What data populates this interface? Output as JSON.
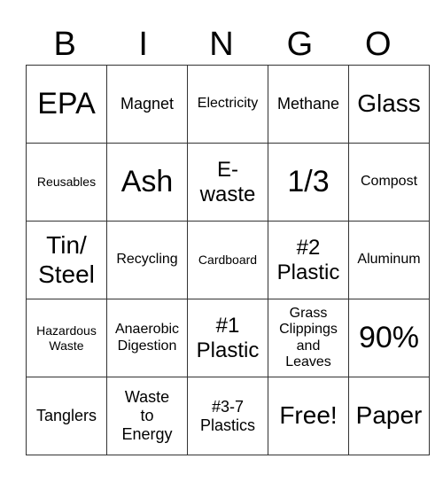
{
  "header": [
    "B",
    "I",
    "N",
    "G",
    "O"
  ],
  "rows": [
    [
      "EPA",
      "Magnet",
      "Electricity",
      "Methane",
      "Glass"
    ],
    [
      "Reusables",
      "Ash",
      "E-\nwaste",
      "1/3",
      "Compost"
    ],
    [
      "Tin/\nSteel",
      "Recycling",
      "Cardboard",
      "#2\nPlastic",
      "Aluminum"
    ],
    [
      "Hazardous\nWaste",
      "Anaerobic\nDigestion",
      "#1\nPlastic",
      "Grass\nClippings\nand\nLeaves",
      "90%"
    ],
    [
      "Tanglers",
      "Waste\nto\nEnergy",
      "#3-7\nPlastics",
      "Free!",
      "Paper"
    ]
  ]
}
